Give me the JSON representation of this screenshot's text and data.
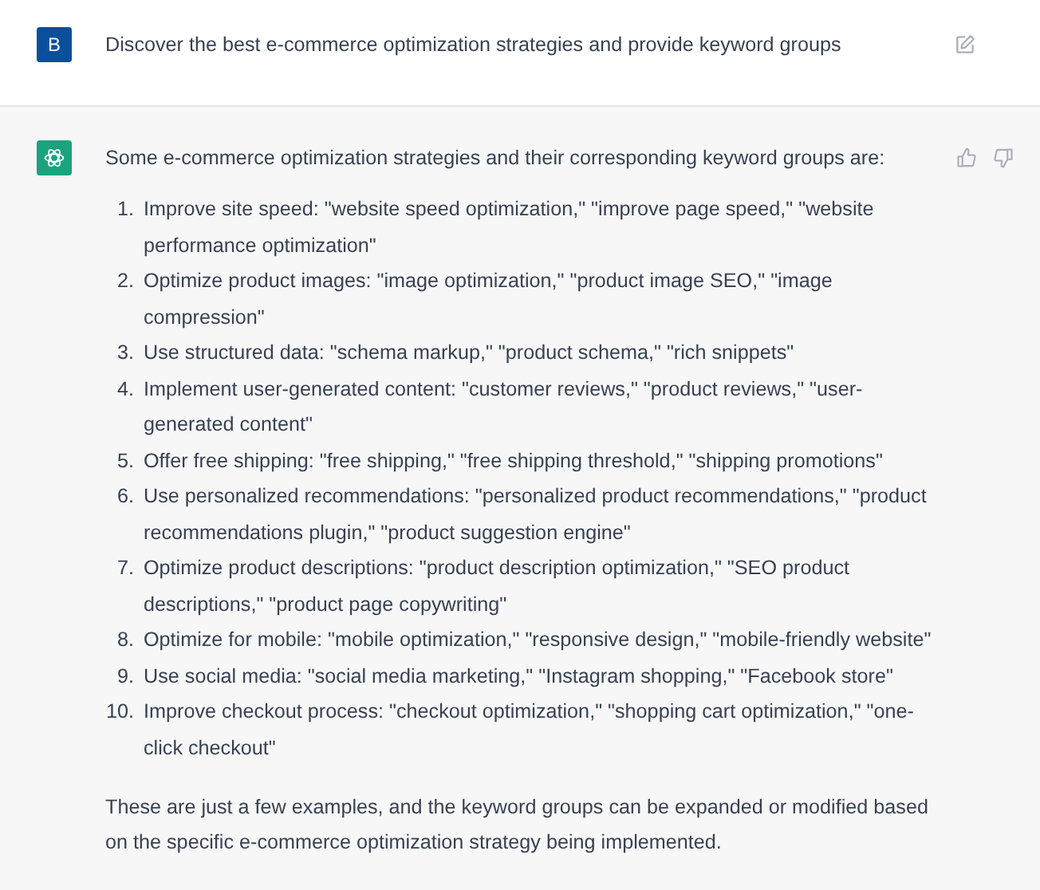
{
  "user_message": {
    "avatar": "B",
    "text": "Discover the best e-commerce optimization strategies and provide keyword groups"
  },
  "assistant_message": {
    "intro": "Some e-commerce optimization strategies and their corresponding keyword groups are:",
    "items": [
      {
        "number": "1.",
        "text": "Improve site speed: \"website speed optimization,\" \"improve page speed,\" \"website performance optimization\""
      },
      {
        "number": "2.",
        "text": "Optimize product images: \"image optimization,\" \"product image SEO,\" \"image compression\""
      },
      {
        "number": "3.",
        "text": "Use structured data: \"schema markup,\" \"product schema,\" \"rich snippets\""
      },
      {
        "number": "4.",
        "text": "Implement user-generated content: \"customer reviews,\" \"product reviews,\" \"user-generated content\""
      },
      {
        "number": "5.",
        "text": "Offer free shipping: \"free shipping,\" \"free shipping threshold,\" \"shipping promotions\""
      },
      {
        "number": "6.",
        "text": "Use personalized recommendations: \"personalized product recommendations,\" \"product recommendations plugin,\" \"product suggestion engine\""
      },
      {
        "number": "7.",
        "text": "Optimize product descriptions: \"product description optimization,\" \"SEO product descriptions,\" \"product page copywriting\""
      },
      {
        "number": "8.",
        "text": "Optimize for mobile: \"mobile optimization,\" \"responsive design,\" \"mobile-friendly website\""
      },
      {
        "number": "9.",
        "text": "Use social media: \"social media marketing,\" \"Instagram shopping,\" \"Facebook store\""
      },
      {
        "number": "10.",
        "text": "Improve checkout process: \"checkout optimization,\" \"shopping cart optimization,\" \"one-click checkout\""
      }
    ],
    "outro": "These are just a few examples, and the keyword groups can be expanded or modified based on the specific e-commerce optimization strategy being implemented."
  }
}
